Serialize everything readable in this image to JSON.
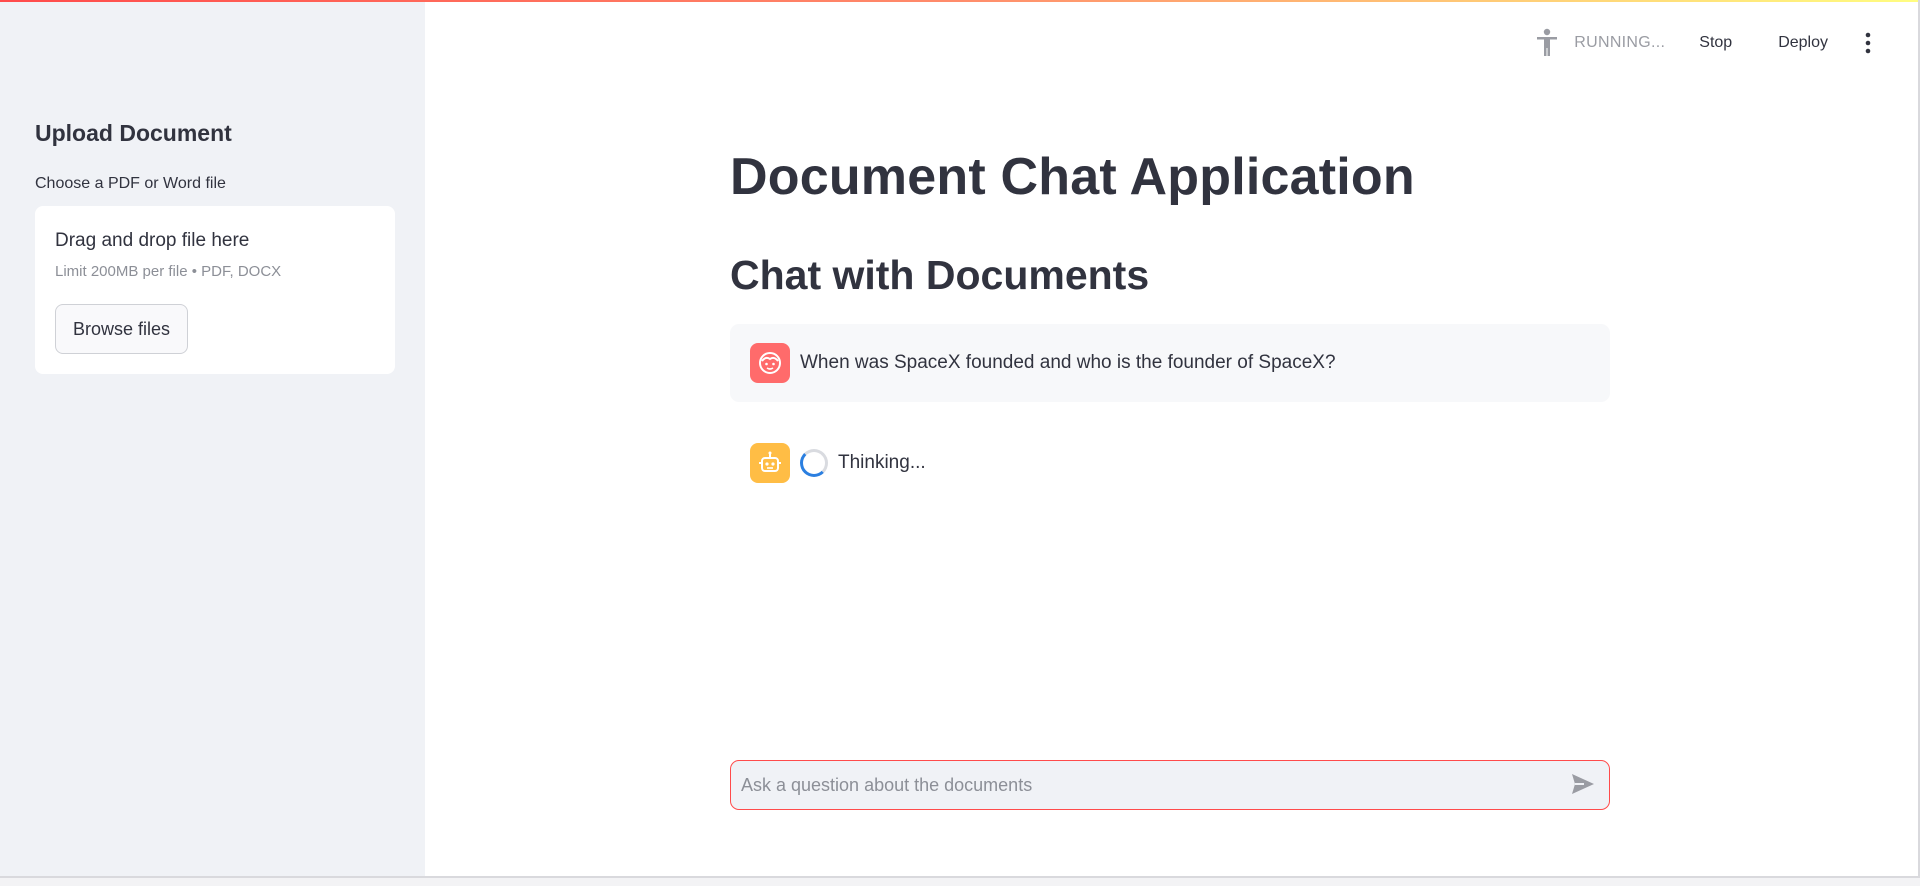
{
  "sidebar": {
    "title": "Upload Document",
    "uploader_label": "Choose a PDF or Word file",
    "dropzone_title": "Drag and drop file here",
    "dropzone_limit": "Limit 200MB per file • PDF, DOCX",
    "browse_label": "Browse files"
  },
  "toolbar": {
    "status_text": "RUNNING...",
    "stop_label": "Stop",
    "deploy_label": "Deploy",
    "run_icon": "running-man-icon",
    "menu_icon": "kebab-menu-icon"
  },
  "main": {
    "title": "Document Chat Application",
    "subtitle": "Chat with Documents"
  },
  "chat": {
    "messages": [
      {
        "role": "user",
        "avatar": "user-face-icon",
        "text": "When was SpaceX founded and who is the founder of SpaceX?"
      },
      {
        "role": "assistant",
        "avatar": "robot-icon",
        "text": "Thinking..."
      }
    ],
    "input_placeholder": "Ask a question about the documents",
    "input_value": ""
  },
  "colors": {
    "accent": "#ff4b4b",
    "sidebar_bg": "#f0f2f6",
    "user_avatar": "#ff6b6b",
    "bot_avatar": "#ffbd45",
    "spinner": "#2b7fe0"
  }
}
